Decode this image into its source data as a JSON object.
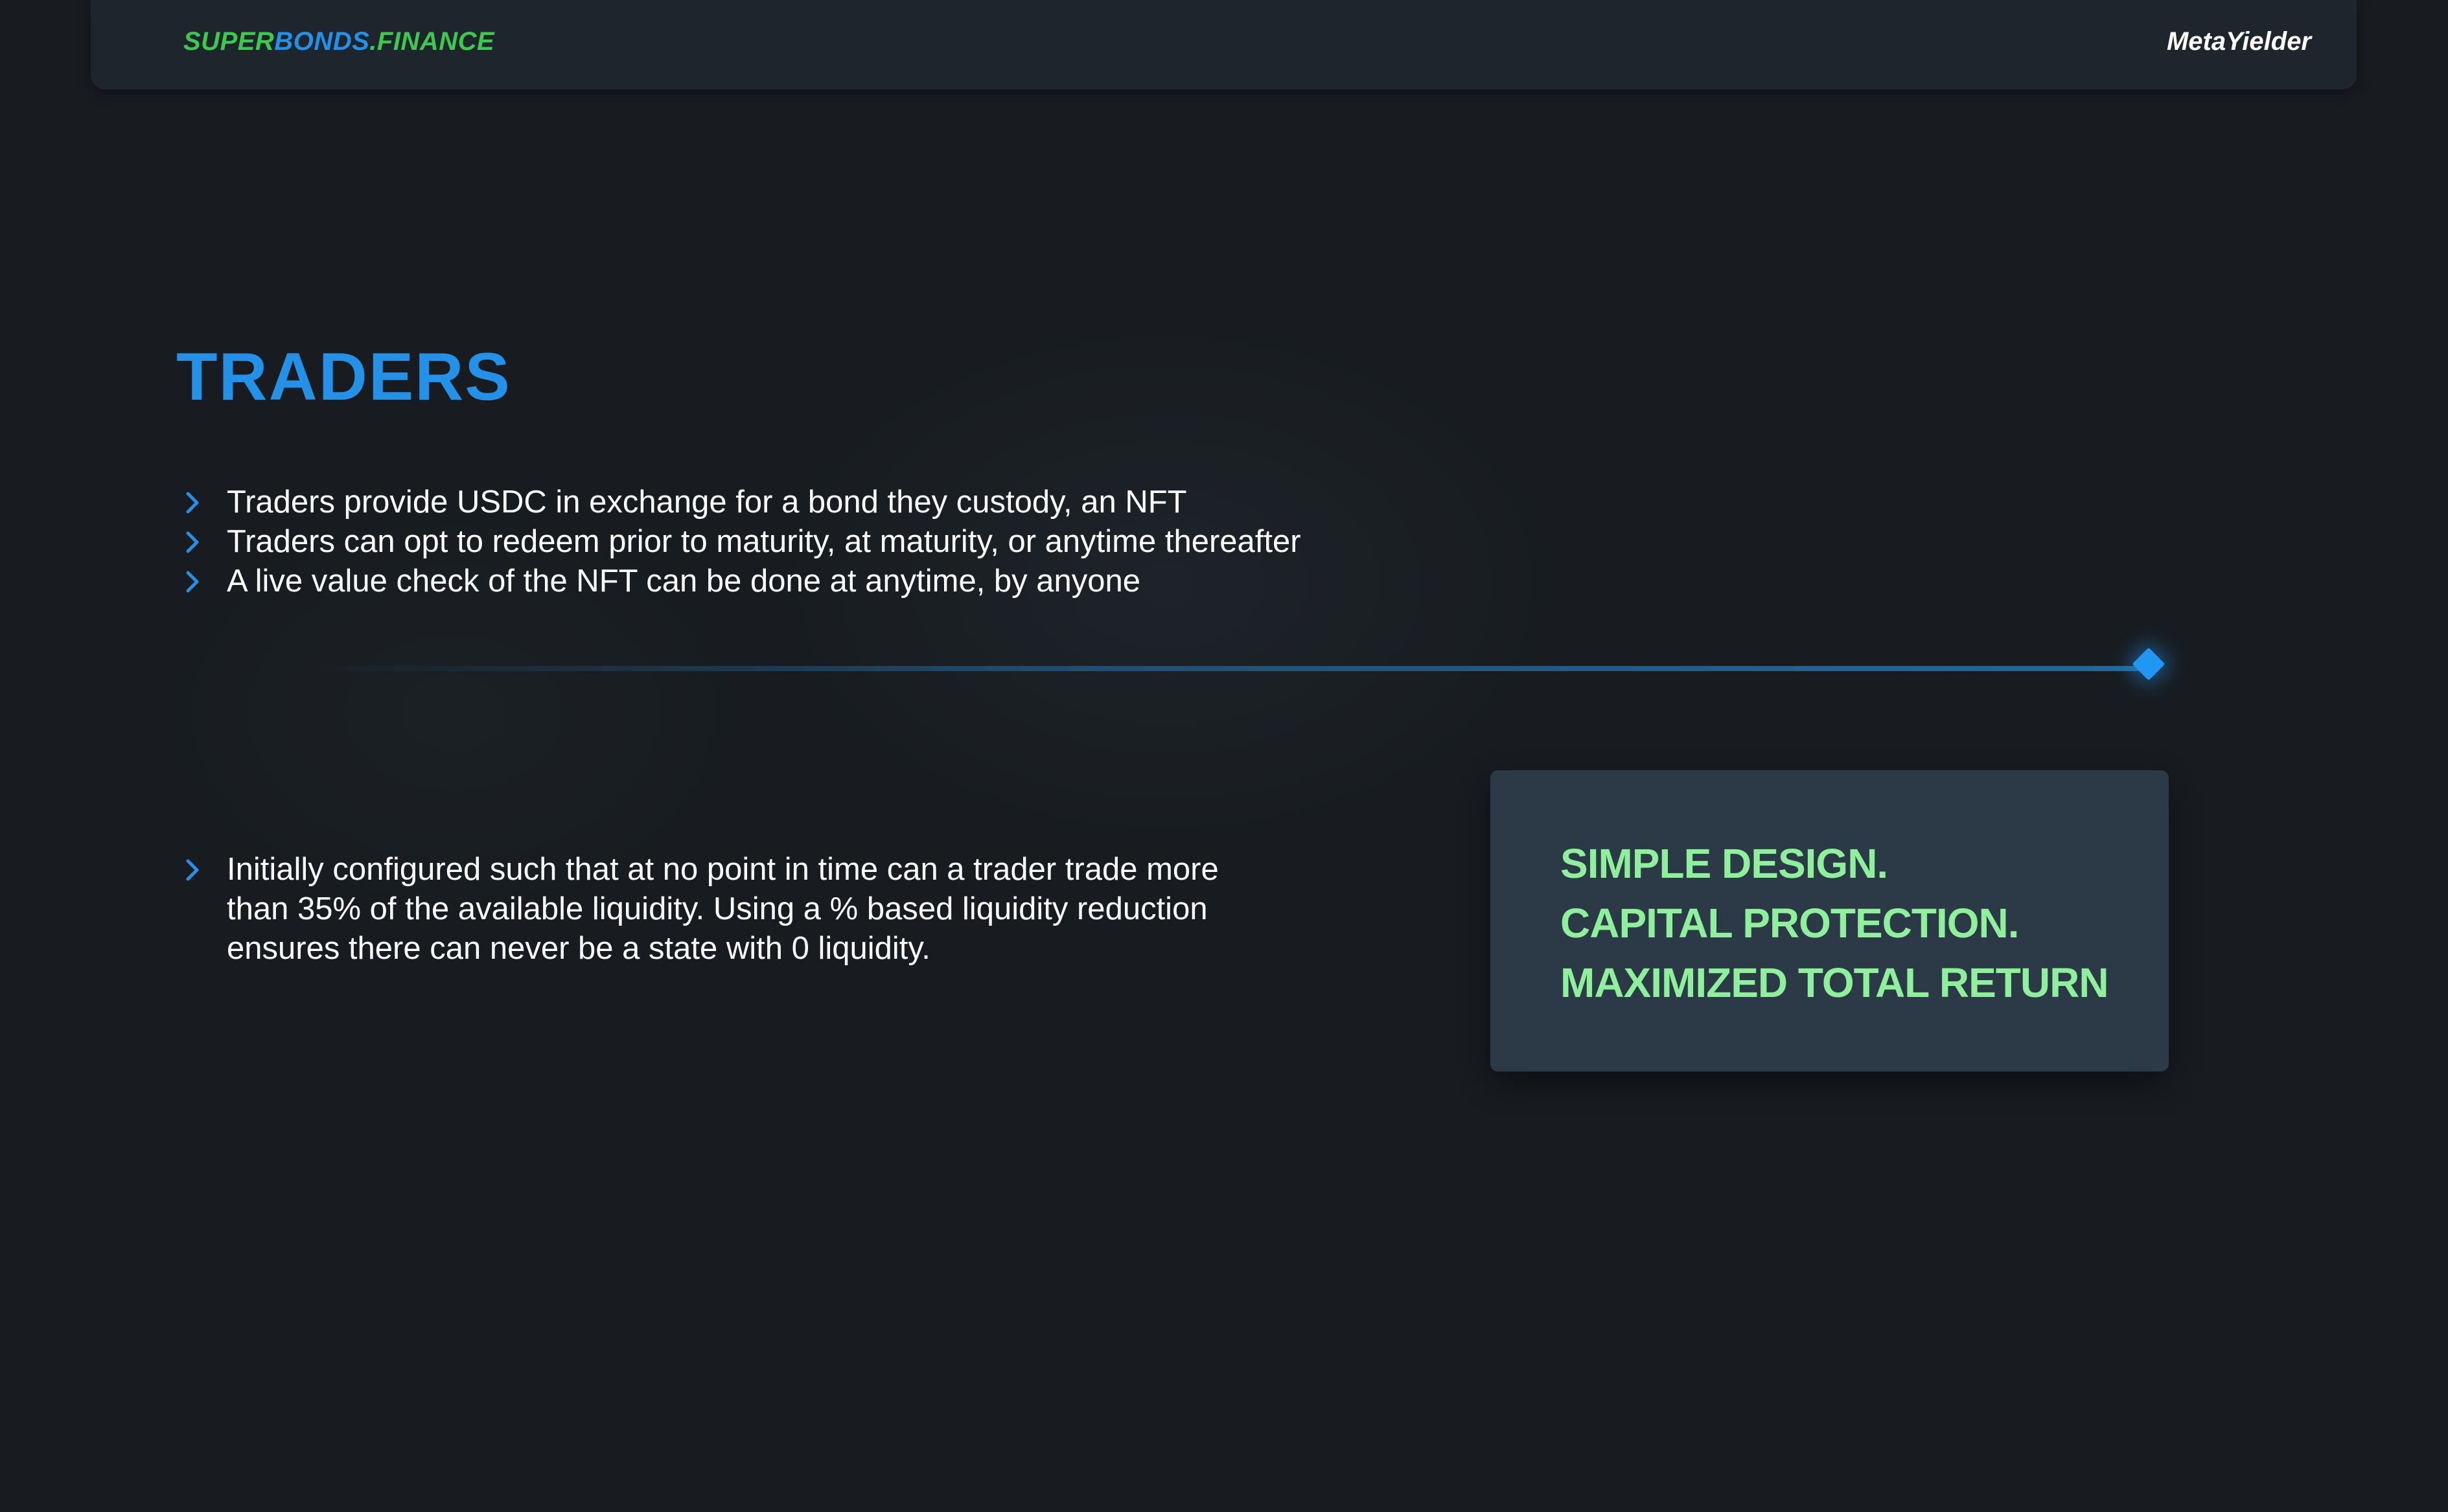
{
  "header": {
    "logo_part1": "SUPER",
    "logo_part2": "BONDS",
    "logo_part3": ".FINANCE",
    "brand_right": "MetaYielder"
  },
  "title": "TRADERS",
  "bullets": [
    "Traders provide USDC in exchange for a bond they custody, an NFT",
    "Traders can opt to redeem prior to maturity, at maturity, or anytime thereafter",
    "A live value check of the NFT can be done at anytime, by anyone"
  ],
  "paragraph": "Initially configured such that at no point in time can a trader trade more than 35% of the available liquidity. Using a % based liquidity reduction ensures there can never be a state with 0 liquidity.",
  "callout": {
    "lines": [
      "SIMPLE DESIGN.",
      "CAPITAL PROTECTION.",
      "MAXIMIZED TOTAL RETURN"
    ]
  },
  "colors": {
    "background": "#181c20",
    "accent_blue": "#2491e8",
    "logo_green": "#3ec94e",
    "callout_green": "#8ef09a",
    "callout_bg": "#2c3a47"
  },
  "icons": {
    "bullet": "chevron-right-icon",
    "divider_marker": "diamond-icon"
  }
}
